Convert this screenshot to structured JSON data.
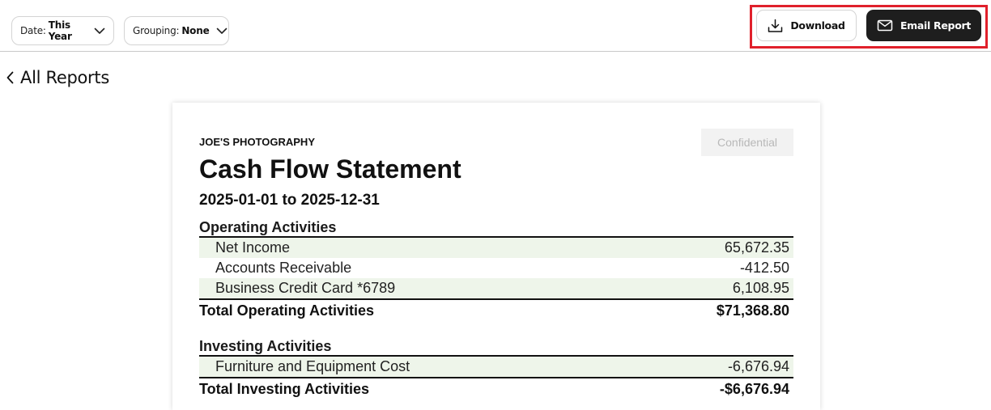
{
  "toolbar": {
    "date_filter": {
      "label": "Date:",
      "value": "This Year"
    },
    "grouping_filter": {
      "label": "Grouping:",
      "value": "None"
    },
    "download_label": "Download",
    "email_label": "Email Report"
  },
  "nav": {
    "back_label": "All Reports"
  },
  "report": {
    "company": "JOE'S PHOTOGRAPHY",
    "badge": "Confidential",
    "title": "Cash Flow Statement",
    "period": "2025-01-01 to 2025-12-31",
    "operating": {
      "heading": "Operating Activities",
      "rows": [
        {
          "name": "Net Income",
          "amount": "65,672.35"
        },
        {
          "name": "Accounts Receivable",
          "amount": "-412.50"
        },
        {
          "name": "Business Credit Card *6789",
          "amount": "6,108.95"
        }
      ],
      "total_label": "Total Operating Activities",
      "total_amount": "$71,368.80"
    },
    "investing": {
      "heading": "Investing Activities",
      "rows": [
        {
          "name": "Furniture and Equipment Cost",
          "amount": "-6,676.94"
        }
      ],
      "total_label": "Total Investing Activities",
      "total_amount": "-$6,676.94"
    }
  },
  "colors": {
    "primary_button": "#1e1e1e",
    "highlight": "#e0202b",
    "row_shade": "#eef5ea"
  }
}
